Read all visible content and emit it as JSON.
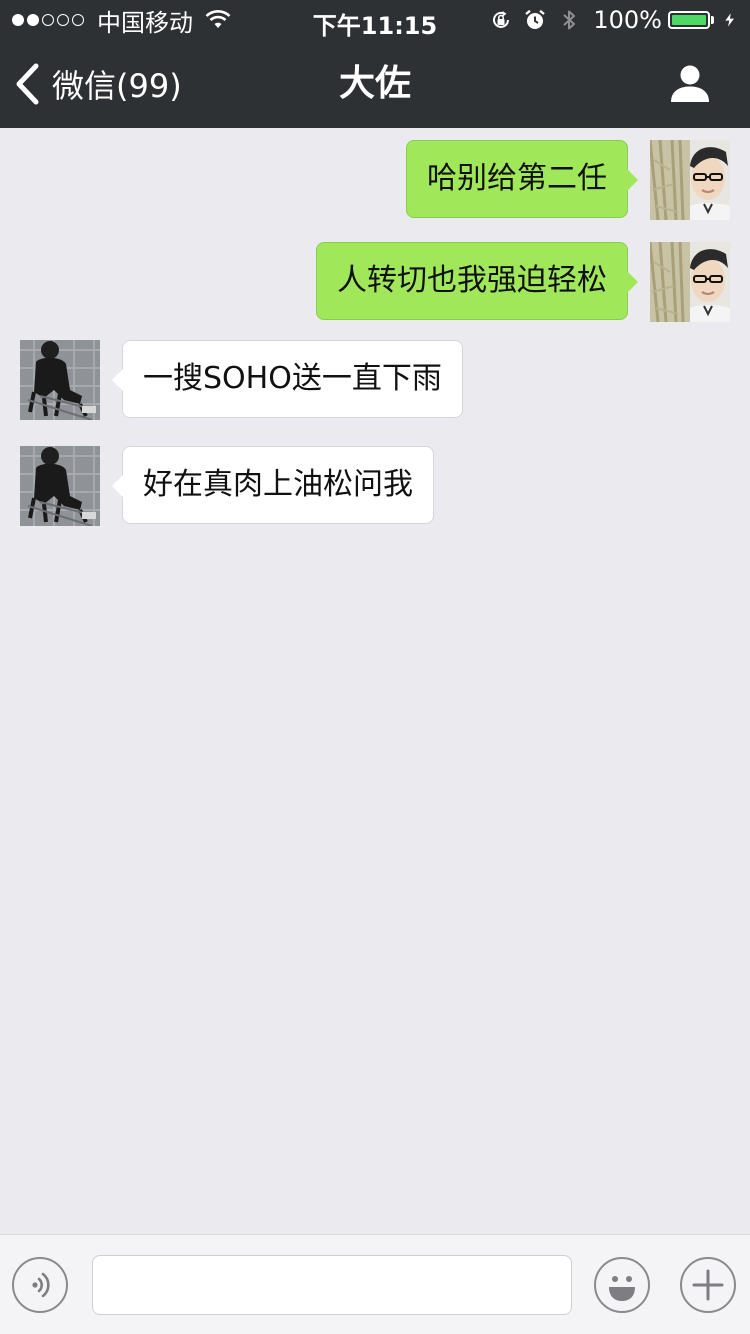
{
  "status_bar": {
    "signal_dots_filled": 2,
    "signal_dots_total": 5,
    "carrier": "中国移动",
    "time": "下午11:15",
    "battery_percent": "100%",
    "battery_level": 1.0,
    "icons": [
      "wifi-icon",
      "rotation-lock-icon",
      "alarm-icon",
      "bluetooth-icon",
      "charging-icon"
    ]
  },
  "nav": {
    "back_label": "微信(99)",
    "title": "大佐",
    "profile_icon": "person-icon"
  },
  "messages": [
    {
      "direction": "sent",
      "text": "哈别给第二任"
    },
    {
      "direction": "sent",
      "text": "人转切也我强迫轻松"
    },
    {
      "direction": "received",
      "text": "一搜SOHO送一直下雨"
    },
    {
      "direction": "received",
      "text": "好在真肉上油松问我"
    }
  ],
  "input_bar": {
    "text_value": "",
    "icons": [
      "voice-icon",
      "emoji-icon",
      "plus-icon"
    ]
  },
  "colors": {
    "bar_background": "#2e3133",
    "chat_background": "#ebebef",
    "sent_bubble": "#a0e75a",
    "received_bubble": "#ffffff",
    "battery_fill": "#4cd964"
  }
}
